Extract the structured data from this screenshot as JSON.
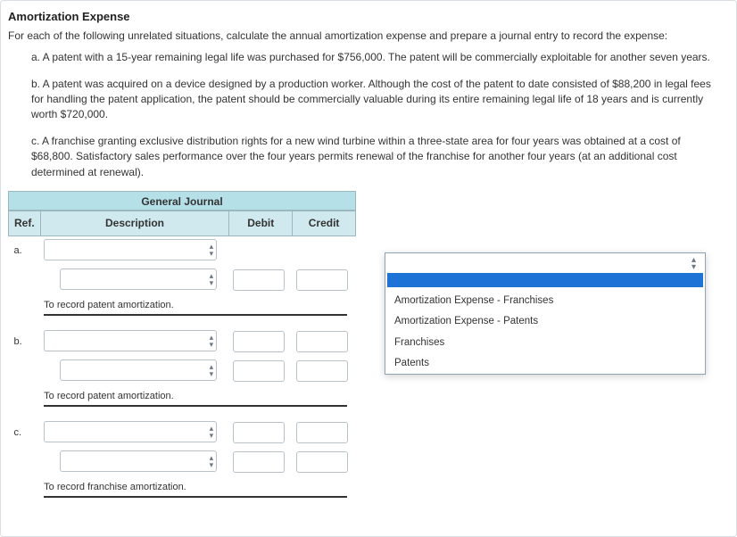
{
  "title": "Amortization Expense",
  "instructions": "For each of the following unrelated situations, calculate the annual amortization expense and prepare a journal entry to record the expense:",
  "items": {
    "a": "a. A patent with a 15-year remaining legal life was purchased for $756,000. The patent will be commercially exploitable for another seven years.",
    "b": "b. A patent was acquired on a device designed by a production worker. Although the cost of the patent to date consisted of $88,200 in legal fees for handling the patent application, the patent should be commercially valuable during its entire remaining legal life of 18 years and is currently worth $720,000.",
    "c": "c. A franchise granting exclusive distribution rights for a new wind turbine within a three-state area for four years was obtained at a cost of $68,800. Satisfactory sales performance over the four years permits renewal of the franchise for another four years (at an additional cost determined at renewal)."
  },
  "journal": {
    "heading": "General Journal",
    "cols": {
      "ref": "Ref.",
      "desc": "Description",
      "debit": "Debit",
      "credit": "Credit"
    },
    "refs": {
      "a": "a.",
      "b": "b.",
      "c": "c."
    },
    "memo_a": "To record patent amortization.",
    "memo_b": "To record patent amortization.",
    "memo_c": "To record franchise amortization."
  },
  "dropdown": {
    "options": [
      "Amortization Expense - Franchises",
      "Amortization Expense - Patents",
      "Franchises",
      "Patents"
    ]
  }
}
